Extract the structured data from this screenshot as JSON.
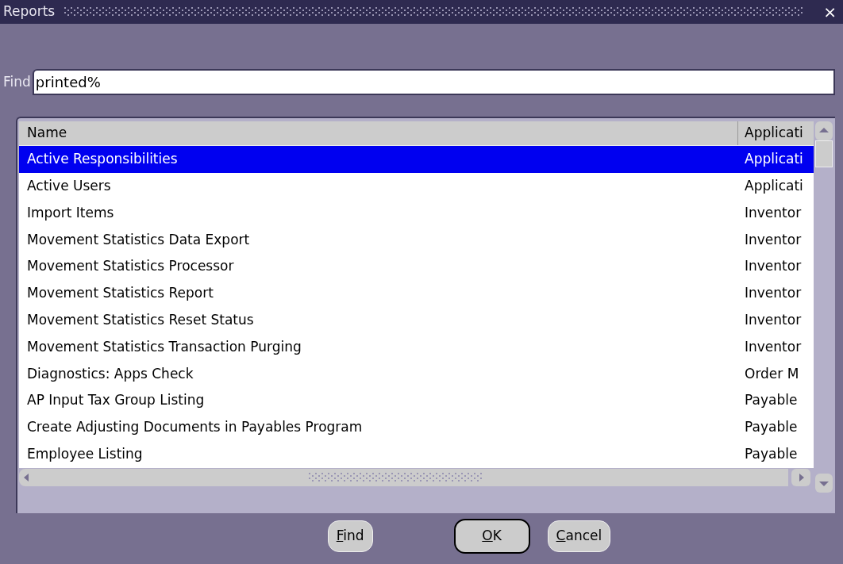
{
  "window": {
    "title": "Reports",
    "close": "×"
  },
  "find": {
    "label": "Find",
    "value": "printed%"
  },
  "table": {
    "columns": [
      "Name",
      "Applicati"
    ],
    "rows": [
      {
        "cells": [
          "Active Responsibilities",
          "Applicati"
        ],
        "selected": true
      },
      {
        "cells": [
          "Active Users",
          "Applicati"
        ],
        "selected": false
      },
      {
        "cells": [
          "Import Items",
          "Inventor"
        ],
        "selected": false
      },
      {
        "cells": [
          "Movement Statistics Data Export",
          "Inventor"
        ],
        "selected": false
      },
      {
        "cells": [
          "Movement Statistics Processor",
          "Inventor"
        ],
        "selected": false
      },
      {
        "cells": [
          "Movement Statistics Report",
          "Inventor"
        ],
        "selected": false
      },
      {
        "cells": [
          "Movement Statistics Reset Status",
          "Inventor"
        ],
        "selected": false
      },
      {
        "cells": [
          "Movement Statistics Transaction Purging",
          "Inventor"
        ],
        "selected": false
      },
      {
        "cells": [
          "Diagnostics: Apps Check",
          "Order M"
        ],
        "selected": false
      },
      {
        "cells": [
          "AP Input Tax Group Listing",
          "Payable"
        ],
        "selected": false
      },
      {
        "cells": [
          "Create Adjusting Documents in Payables Program",
          "Payable"
        ],
        "selected": false
      },
      {
        "cells": [
          "Employee Listing",
          "Payable"
        ],
        "selected": false
      }
    ]
  },
  "buttons": [
    {
      "label": "Find",
      "kind": "plain"
    },
    {
      "label": "OK",
      "kind": "default"
    },
    {
      "label": "Cancel",
      "kind": "plain"
    }
  ]
}
